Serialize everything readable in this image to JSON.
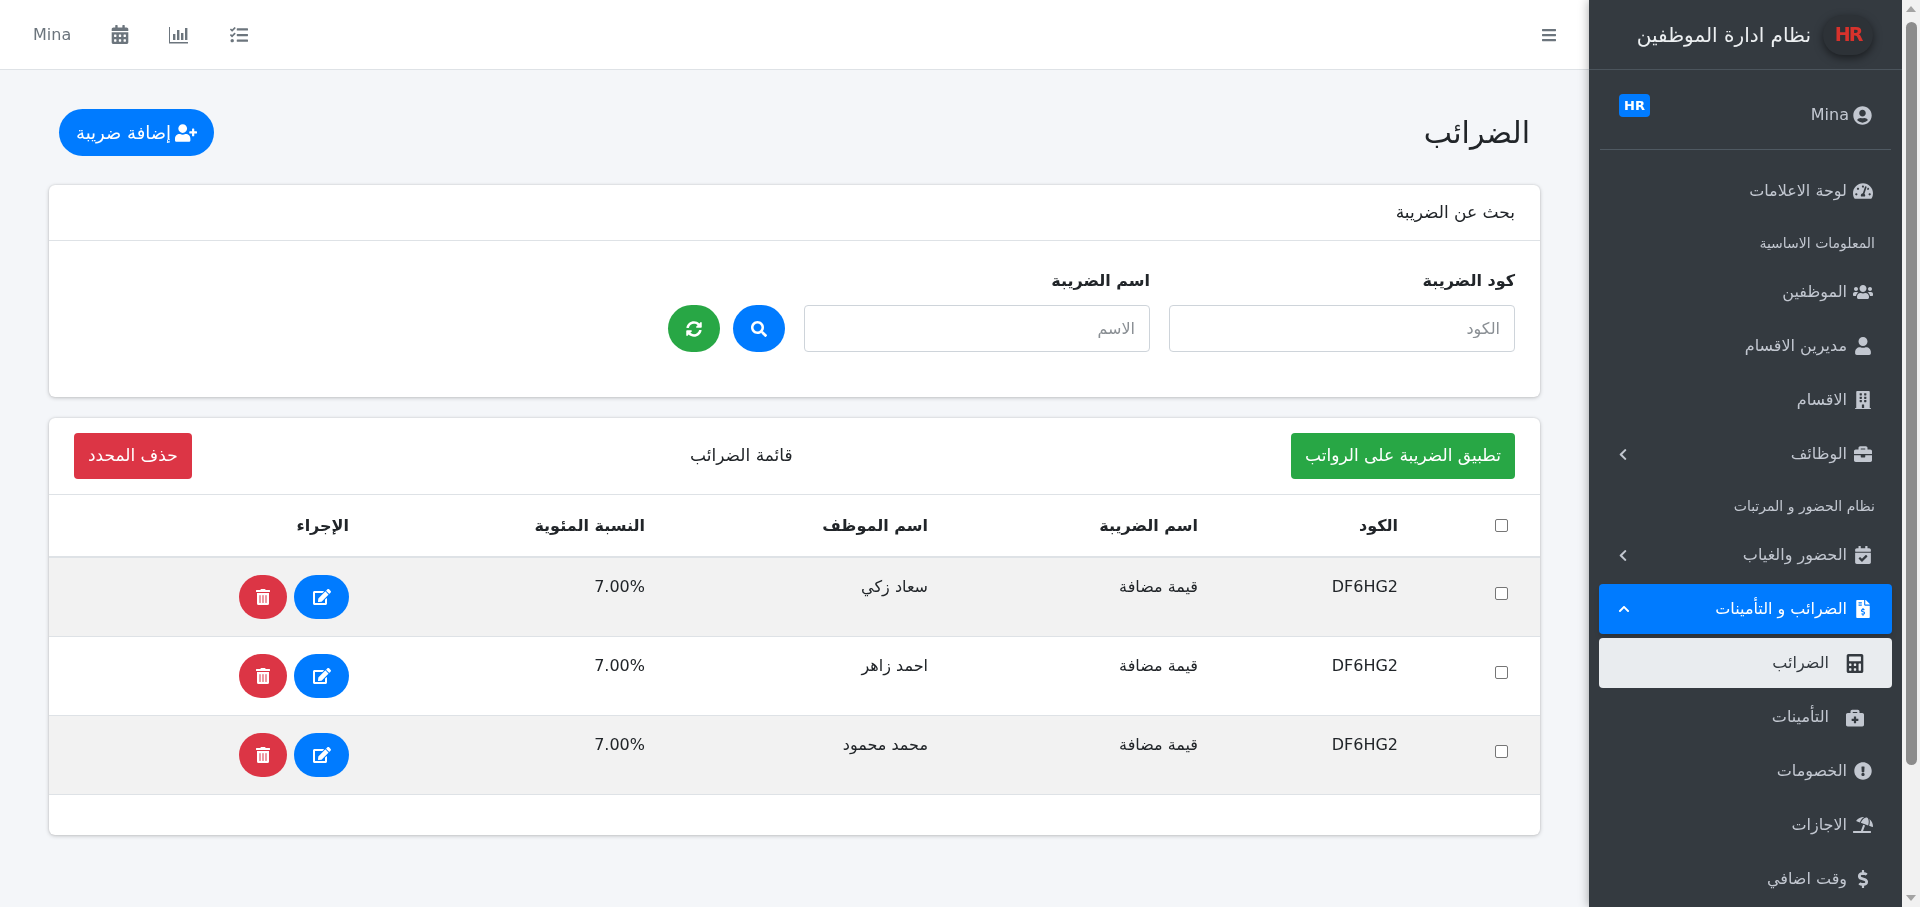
{
  "topbar": {
    "user_name": "Mina"
  },
  "sidebar": {
    "brand": {
      "logo": "HR",
      "title": "نظام ادارة الموظفين"
    },
    "user": {
      "name": "Mina",
      "badge": "HR"
    },
    "nav": [
      {
        "kind": "item",
        "label": "لوحة الاعلامات",
        "selected": false
      },
      {
        "kind": "header",
        "label": "المعلومات الاساسية"
      },
      {
        "kind": "item",
        "label": "الموظفين",
        "selected": false
      },
      {
        "kind": "item",
        "label": "مديرين الاقسام",
        "selected": false
      },
      {
        "kind": "item",
        "label": "الاقسام",
        "selected": false
      },
      {
        "kind": "item",
        "label": "الوظائف",
        "selected": false,
        "expanded": false
      },
      {
        "kind": "header",
        "label": "نظام الحضور و المرتبات"
      },
      {
        "kind": "item",
        "label": "الحضور والغياب",
        "selected": false,
        "expanded": false
      },
      {
        "kind": "item",
        "label": "الضرائب و التأمينات",
        "selected": true,
        "expanded": true,
        "children": [
          {
            "label": "الضرائب",
            "selected": true
          },
          {
            "label": "التأمينات",
            "selected": false
          }
        ]
      },
      {
        "kind": "item",
        "label": "الخصومات",
        "selected": false
      },
      {
        "kind": "item",
        "label": "الاجازات",
        "selected": false
      },
      {
        "kind": "item",
        "label": "وقت اضافي",
        "selected": false
      }
    ]
  },
  "page": {
    "title": "الضرائب",
    "add_button": "إضافة ضريبة"
  },
  "search_card": {
    "title": "بحث عن الضريبة",
    "fields": [
      {
        "label": "كود الضريبة",
        "placeholder": "الكود"
      },
      {
        "label": "اسم الضريبة",
        "placeholder": "الاسم"
      }
    ]
  },
  "table_card": {
    "apply_button": "تطبيق الضريبة على الرواتب",
    "title": "قائمة الضرائب",
    "delete_button": "حذف المحدد",
    "select_all": {
      "checked": false
    },
    "columns": [
      "الكود",
      "اسم الضريبة",
      "اسم الموظف",
      "النسبة المئوية",
      "الإجراء"
    ],
    "rows": [
      {
        "checked": false,
        "cells": [
          "DF6HG2",
          "قيمة مضافة",
          "سعاد زكي",
          "7.00%"
        ]
      },
      {
        "checked": false,
        "cells": [
          "DF6HG2",
          "قيمة مضافة",
          "احمد زاهر",
          "7.00%"
        ]
      },
      {
        "checked": false,
        "cells": [
          "DF6HG2",
          "قيمة مضافة",
          "محمد محمود",
          "7.00%"
        ]
      }
    ]
  }
}
